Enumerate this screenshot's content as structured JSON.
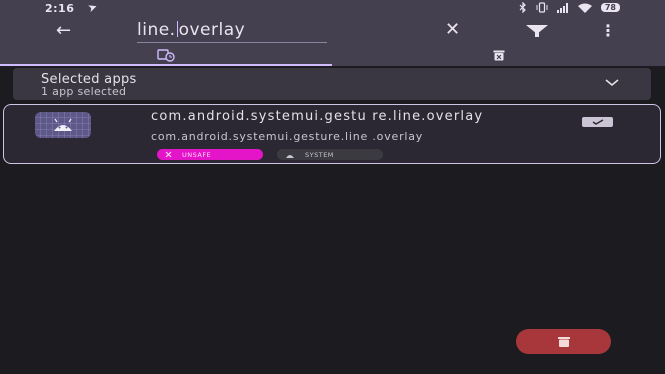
{
  "status_bar": {
    "time": "2:16",
    "battery": "78",
    "icons": [
      "send-icon",
      "bluetooth-icon",
      "vibrate-icon",
      "signal-icon",
      "wifi-icon",
      "battery-icon"
    ]
  },
  "toolbar": {
    "search_text_before_cursor": "line.",
    "search_text_after_cursor": "overlay",
    "icons": [
      "back-arrow-icon",
      "clear-icon",
      "filter-icon",
      "more-icon"
    ]
  },
  "tabs": [
    {
      "icon": "apps-clock-icon",
      "selected": true
    },
    {
      "icon": "trash-icon",
      "selected": false
    }
  ],
  "selected_apps": {
    "title": "Selected apps",
    "subtitle": "1 app selected"
  },
  "app": {
    "name": "com.android.systemui.gestu re.line.overlay",
    "package": "com.android.systemui.gesture.line .overlay",
    "tags": {
      "unsafe": "UNSAFE",
      "system": "SYSTEM"
    },
    "checked": true
  },
  "colors": {
    "toolbar_bg": "#45404f",
    "background": "#1c1b20",
    "accent": "#cfbcff",
    "unsafe_chip": "#e415c9",
    "fab": "#a8373b"
  }
}
